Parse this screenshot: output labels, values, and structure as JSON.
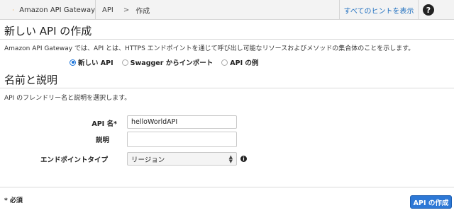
{
  "header": {
    "app_title": "Amazon API Gateway",
    "logo_icon": "api-gateway-logo-icon",
    "breadcrumb": {
      "root": "API",
      "separator": ">",
      "current": "作成"
    },
    "hints_link": "すべてのヒントを表示",
    "help_icon": "help-icon",
    "help_glyph": "?"
  },
  "section": {
    "title": "新しい API の作成",
    "intro": "Amazon API Gateway では、API とは、HTTPS エンドポイントを通じて呼び出し可能なリソースおよびメソッドの集合体のことを示します。",
    "options": [
      {
        "label": "新しい API",
        "selected": true
      },
      {
        "label": "Swagger からインポート",
        "selected": false
      },
      {
        "label": "API の例",
        "selected": false
      }
    ]
  },
  "details": {
    "title": "名前と説明",
    "description": "API のフレンドリー名と説明を選択します。",
    "api_name_label": "API 名*",
    "api_name_value": "helloWorldAPI",
    "description_label": "説明",
    "description_value": "",
    "endpoint_label": "エンドポイントタイプ",
    "endpoint_value": "リージョン",
    "info_glyph": "i"
  },
  "footer": {
    "required_note": "* 必須",
    "create_button": "API の作成"
  },
  "colors": {
    "accent": "#2d78d6",
    "link": "#1f6fbf"
  }
}
